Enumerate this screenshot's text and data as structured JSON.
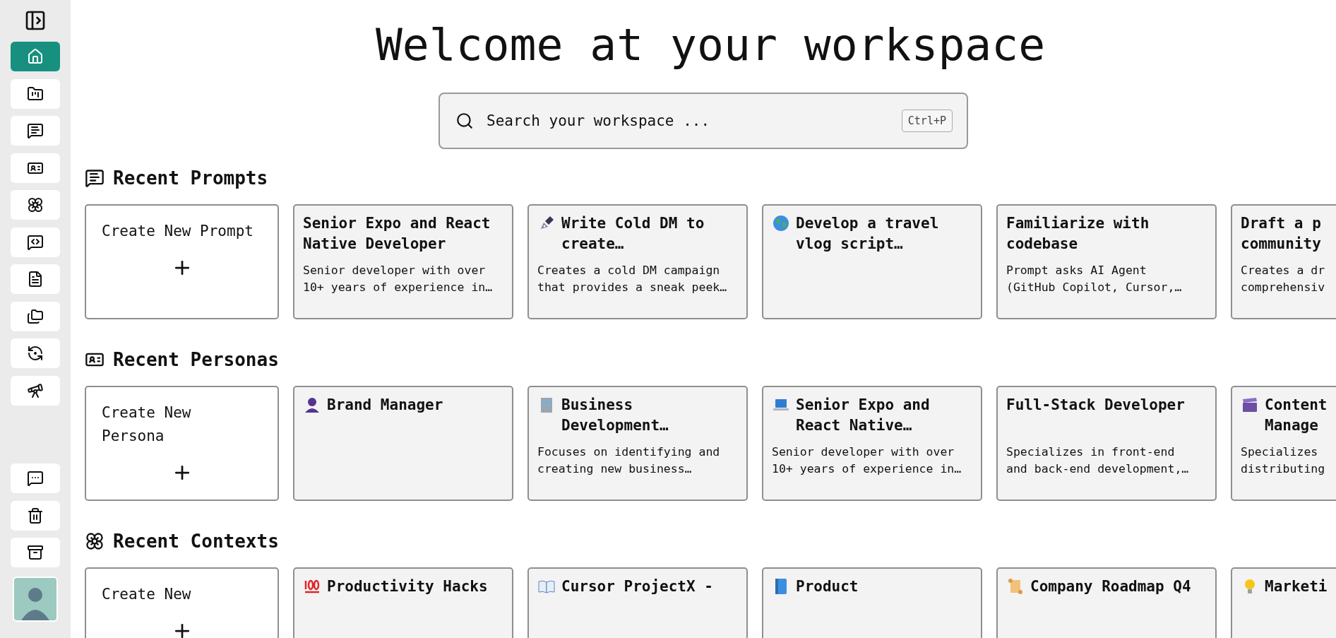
{
  "sidebar": {
    "items": [
      {
        "selected": true
      },
      {
        "selected": false
      },
      {
        "selected": false
      },
      {
        "selected": false
      },
      {
        "selected": false
      },
      {
        "selected": false
      },
      {
        "selected": false
      },
      {
        "selected": false
      },
      {
        "selected": false
      },
      {
        "selected": false
      }
    ]
  },
  "title": "Welcome at your workspace",
  "search": {
    "placeholder": "Search your workspace ...",
    "shortcut": "Ctrl+P"
  },
  "sections": [
    {
      "kind": "prompts",
      "heading": "Recent Prompts",
      "create_label": "Create New Prompt",
      "cards": [
        {
          "kind": "plain",
          "title": "Senior Expo and React\nNative Developer",
          "description": "Senior developer with over\n10+ years of experience in…"
        },
        {
          "kind": "pen",
          "title": "Write Cold DM to\ncreate…",
          "description": "Creates a cold DM campaign\nthat provides a sneak peek…"
        },
        {
          "kind": "globe",
          "title": "Develop a travel\nvlog script…"
        },
        {
          "kind": "plain",
          "title": "Familiarize with\ncodebase",
          "description": "Prompt asks AI Agent\n(GitHub Copilot, Cursor,…"
        },
        {
          "kind": "plain",
          "title": "Draft a p\ncommunity",
          "description": "Creates a dr\ncomprehensiv"
        }
      ]
    },
    {
      "kind": "personas",
      "heading": "Recent Personas",
      "create_label": "Create New\nPersona",
      "cards": [
        {
          "kind": "person",
          "title": "Brand Manager"
        },
        {
          "kind": "building",
          "title": "Business\nDevelopment…",
          "description": "Focuses on identifying and\ncreating new business…"
        },
        {
          "kind": "laptop",
          "title": "Senior Expo and\nReact Native…",
          "description": "Senior developer with over\n10+ years of experience in…"
        },
        {
          "kind": "plain",
          "title": "Full-Stack Developer",
          "description": "Specializes in front-end\nand back-end development,…"
        },
        {
          "kind": "clapper",
          "title": "Content\nManage",
          "description": "Specializes\ndistributing"
        }
      ]
    },
    {
      "kind": "contexts",
      "heading": "Recent Contexts",
      "create_label": "Create New",
      "cards": [
        {
          "kind": "hundred",
          "title": "Productivity Hacks"
        },
        {
          "kind": "book",
          "title": "Cursor ProjectX -"
        },
        {
          "kind": "bluebook",
          "title": "Product"
        },
        {
          "kind": "scroll",
          "title": "Company Roadmap Q4"
        },
        {
          "kind": "bulb",
          "title": "Marketi"
        }
      ]
    }
  ]
}
